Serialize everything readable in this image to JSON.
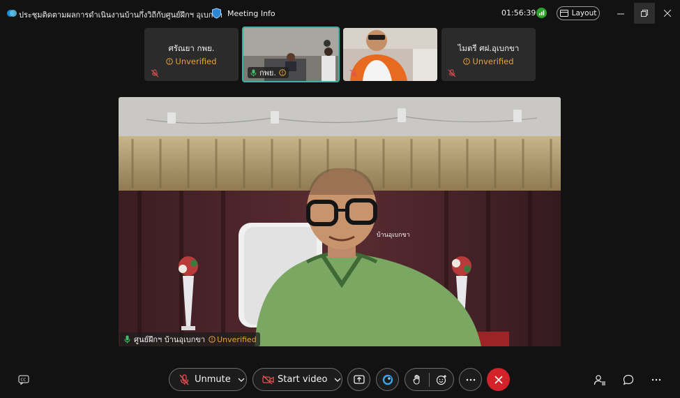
{
  "titlebar": {
    "meeting_title": "ประชุมติดตามผลการดำเนินงานบ้านกึ่งวิถีกับศูนย์ฝึกฯ อุเบกขา",
    "meeting_info": "Meeting Info",
    "timer": "01:56:39",
    "layout_label": "Layout"
  },
  "filmstrip": [
    {
      "name": "ศรัณยา กพย.",
      "status": "Unverified",
      "muted": true
    },
    {
      "name": "กพย.",
      "status": "",
      "muted": false,
      "active": true
    },
    {
      "name": "",
      "status": "",
      "muted": true
    },
    {
      "name": "ไมตรี ศฝ.อุเบกขา",
      "status": "Unverified",
      "muted": true
    }
  ],
  "main": {
    "name": "ศูนย์ฝึกฯ บ้านอุเบกขา",
    "status": "Unverified",
    "chair_label": "บ้านอุเบกขา"
  },
  "controls": {
    "unmute_label": "Unmute",
    "start_video_label": "Start video"
  },
  "colors": {
    "accent_teal": "#39b3a8",
    "unverified": "#e8a23a",
    "end_call": "#d2232a",
    "mic_muted": "#e05252",
    "mic_active": "#3cc36a"
  }
}
